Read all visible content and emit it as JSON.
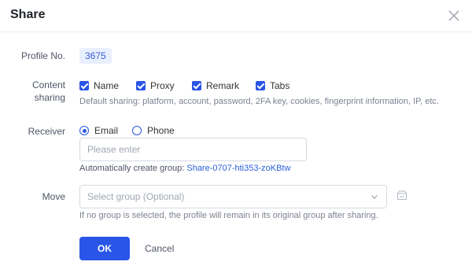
{
  "dialog": {
    "title": "Share"
  },
  "profile": {
    "label": "Profile No.",
    "value": "3675"
  },
  "content_sharing": {
    "label_line1": "Content",
    "label_line2": "sharing",
    "options": [
      {
        "label": "Name",
        "checked": true
      },
      {
        "label": "Proxy",
        "checked": true
      },
      {
        "label": "Remark",
        "checked": true
      },
      {
        "label": "Tabs",
        "checked": true
      }
    ],
    "default_hint": "Default sharing: platform, account, password, 2FA key, cookies, fingerprint information, IP, etc."
  },
  "receiver": {
    "label": "Receiver",
    "options": [
      {
        "label": "Email",
        "selected": true
      },
      {
        "label": "Phone",
        "selected": false
      }
    ],
    "input_placeholder": "Please enter",
    "auto_group_prefix": "Automatically create group: ",
    "auto_group_name": "Share-0707-hti353-zoKBtw"
  },
  "move": {
    "label": "Move",
    "select_placeholder": "Select group (Optional)",
    "hint": "If no group is selected, the profile will remain in its original group after sharing."
  },
  "actions": {
    "ok_label": "OK",
    "cancel_label": "Cancel"
  },
  "colors": {
    "accent": "#2955e8",
    "link": "#2b5fd9",
    "pill_bg": "#e8effe"
  },
  "icons": {
    "close": "close-icon",
    "chevron": "chevron-down-icon",
    "folder": "folder-add-icon"
  }
}
